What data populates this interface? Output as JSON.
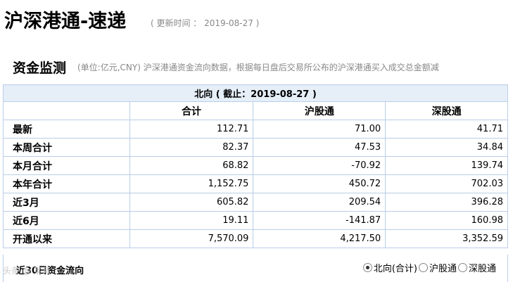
{
  "header": {
    "title": "沪深港通-速递",
    "update_time": "( 更新时间 ： 2019-08-27 )"
  },
  "section": {
    "title": "资金监测",
    "description": "(单位:亿元,CNY)   沪深港通资金流向数据，根据每日盘后交易所公布的沪深港通买入成交总金额减"
  },
  "table": {
    "caption": "北向 ( 截止：2019-08-27 )",
    "columns": [
      "合计",
      "沪股通",
      "深股通"
    ],
    "rows": [
      {
        "label": "最新",
        "values": [
          "112.71",
          "71.00",
          "41.71"
        ]
      },
      {
        "label": "本周合计",
        "values": [
          "82.37",
          "47.53",
          "34.84"
        ]
      },
      {
        "label": "本月合计",
        "values": [
          "68.82",
          "-70.92",
          "139.74"
        ]
      },
      {
        "label": "本年合计",
        "values": [
          "1,152.75",
          "450.72",
          "702.03"
        ]
      },
      {
        "label": "近3月",
        "values": [
          "605.82",
          "209.54",
          "396.28"
        ]
      },
      {
        "label": "近6月",
        "values": [
          "19.11",
          "-141.87",
          "160.98"
        ]
      },
      {
        "label": "开通以来",
        "values": [
          "7,570.09",
          "4,217.50",
          "3,352.59"
        ]
      }
    ]
  },
  "flow30": {
    "title": "近30日资金流向",
    "options": [
      {
        "label": "北向(合计)",
        "checked": true
      },
      {
        "label": "沪股通",
        "checked": false
      },
      {
        "label": "深股通",
        "checked": false
      }
    ]
  },
  "watermark": "头条 @ 某某"
}
